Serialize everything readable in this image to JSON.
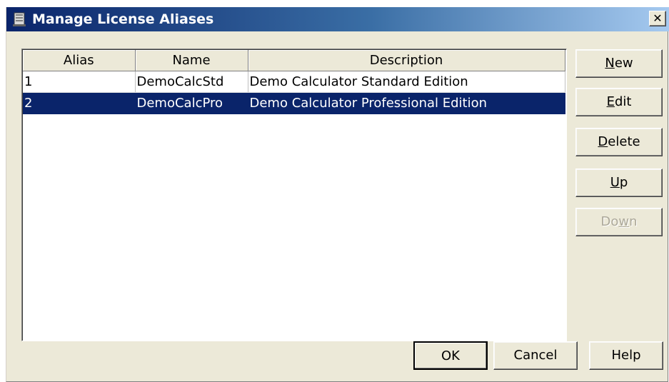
{
  "window": {
    "title": "Manage License Aliases",
    "close_label": "✕"
  },
  "table": {
    "columns": [
      "Alias",
      "Name",
      "Description"
    ],
    "rows": [
      {
        "alias": "1",
        "name": "DemoCalcStd",
        "description": "Demo Calculator Standard Edition"
      },
      {
        "alias": "2",
        "name": "DemoCalcPro",
        "description": "Demo Calculator Professional Edition"
      }
    ],
    "selected_row": 2
  },
  "side_buttons": {
    "new": {
      "label_pre": "",
      "mnemonic": "N",
      "label_post": "ew"
    },
    "edit": {
      "label_pre": "",
      "mnemonic": "E",
      "label_post": "dit"
    },
    "delete": {
      "label_pre": "",
      "mnemonic": "D",
      "label_post": "elete"
    },
    "up": {
      "label_pre": "",
      "mnemonic": "U",
      "label_post": "p"
    },
    "down": {
      "label_pre": "Do",
      "mnemonic": "w",
      "label_post": "n",
      "disabled": true
    }
  },
  "bottom_buttons": {
    "ok": "OK",
    "cancel": "Cancel",
    "help": "Help"
  },
  "colors": {
    "selection": "#0a246a",
    "title_gradient_start": "#0a246a",
    "title_gradient_end": "#a6caf0",
    "dialog_background": "#ece9d8"
  }
}
